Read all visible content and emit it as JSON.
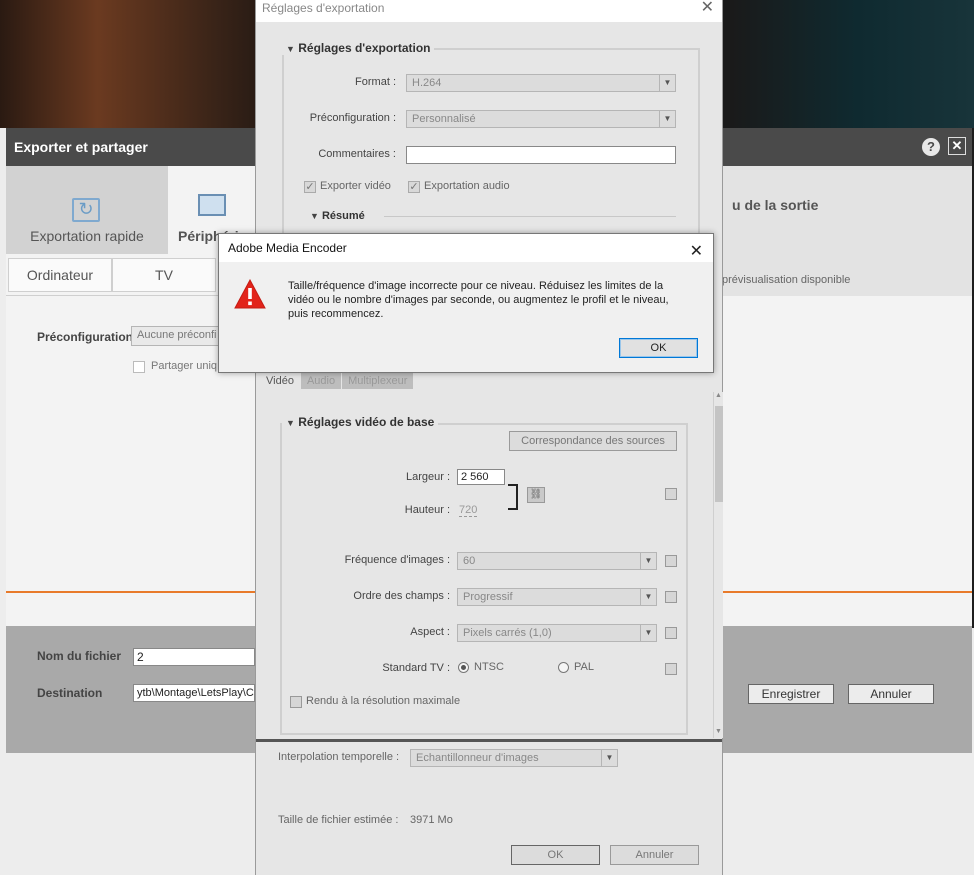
{
  "premiere": {
    "window_title": "Exporter et partager",
    "help_symbol": "?",
    "close_symbol": "✕",
    "tabs": {
      "quick_export": "Exportation rapide",
      "devices": "Périphériq"
    },
    "subtabs": [
      "Ordinateur",
      "TV"
    ],
    "preset_label": "Préconfiguration",
    "preset_value": "Aucune préconfi",
    "share_label": "Partager uniq",
    "output_title": "u de la sortie",
    "preview_text": "prévisualisation disponible",
    "filename_label": "Nom du fichier",
    "filename_value": "2",
    "destination_label": "Destination",
    "destination_value": "ytb\\Montage\\LetsPlay\\C",
    "save_button": "Enregistrer",
    "cancel_button": "Annuler"
  },
  "export_settings": {
    "window_title": "Réglages d'exportation",
    "close_symbol": "✕",
    "section_title": "Réglages d'exportation",
    "format_label": "Format :",
    "format_value": "H.264",
    "preset_label": "Préconfiguration :",
    "preset_value": "Personnalisé",
    "comments_label": "Commentaires :",
    "comments_value": "",
    "export_video": "Exporter vidéo",
    "export_audio": "Exportation audio",
    "summary_title": "Résumé",
    "tabs": [
      "Vidéo",
      "Audio",
      "Multiplexeur"
    ],
    "basic_video_title": "Réglages vidéo de base",
    "match_source_button": "Correspondance des sources",
    "width_label": "Largeur :",
    "width_value": "2 560",
    "height_label": "Hauteur :",
    "height_value": "720",
    "frame_rate_label": "Fréquence d'images :",
    "frame_rate_value": "60",
    "field_order_label": "Ordre des champs :",
    "field_order_value": "Progressif",
    "aspect_label": "Aspect :",
    "aspect_value": "Pixels carrés (1,0)",
    "tv_standard_label": "Standard TV :",
    "tv_ntsc": "NTSC",
    "tv_pal": "PAL",
    "max_render_label": "Rendu à la résolution maximale",
    "time_interp_label": "Interpolation temporelle :",
    "time_interp_value": "Echantillonneur d'images",
    "file_size_label": "Taille de fichier estimée :",
    "file_size_value": "3971 Mo",
    "ok_button": "OK",
    "cancel_button": "Annuler"
  },
  "alert": {
    "title": "Adobe Media Encoder",
    "close_symbol": "✕",
    "icon": "warning-icon",
    "message": "Taille/fréquence d'image incorrecte pour ce niveau. Réduisez les limites de la vidéo ou le nombre d'images par seconde, ou augmentez le profil et le niveau, puis recommencez.",
    "ok_button": "OK"
  },
  "colors": {
    "warning_red": "#e2231a",
    "accent_orange": "#e87a2a",
    "focus_blue": "#0078d7"
  }
}
